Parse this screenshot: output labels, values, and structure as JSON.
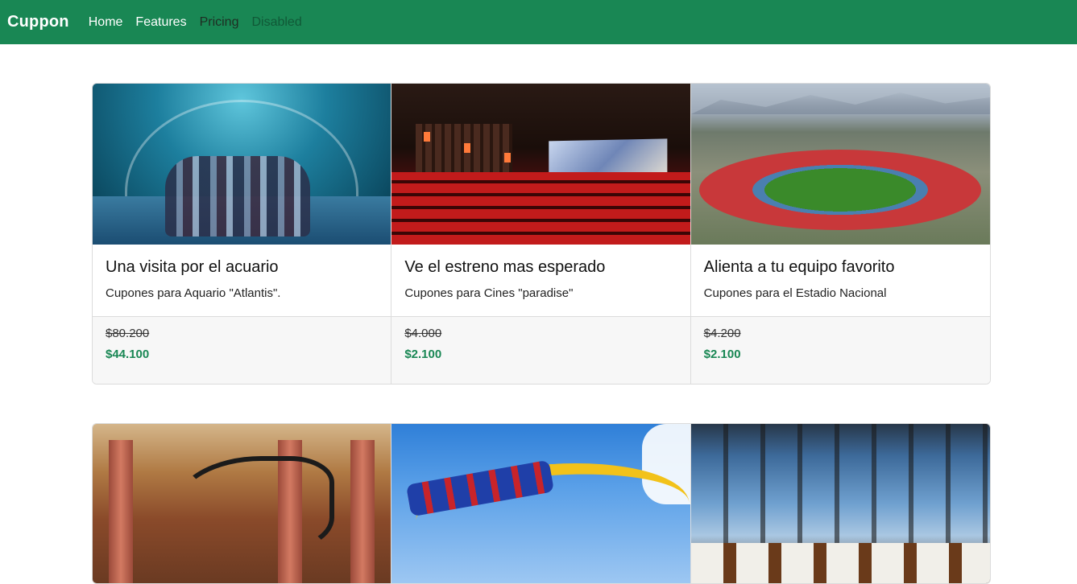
{
  "navbar": {
    "brand": "Cuppon",
    "links": [
      {
        "label": "Home"
      },
      {
        "label": "Features"
      },
      {
        "label": "Pricing"
      },
      {
        "label": "Disabled"
      }
    ]
  },
  "cards_row1": [
    {
      "title": "Una visita por el acuario",
      "text": "Cupones para Aquario \"Atlantis\".",
      "old_price": "$80.200",
      "new_price": "$44.100",
      "image": "aquarium-tunnel-photo"
    },
    {
      "title": "Ve el estreno mas esperado",
      "text": "Cupones para Cines \"paradise\"",
      "old_price": "$4.000",
      "new_price": "$2.100",
      "image": "cinema-theater-photo"
    },
    {
      "title": "Alienta a tu equipo favorito",
      "text": "Cupones para el Estadio Nacional",
      "old_price": "$4.200",
      "new_price": "$2.100",
      "image": "stadium-aerial-photo"
    }
  ],
  "cards_row2": [
    {
      "image": "museum-dinosaur-photo"
    },
    {
      "image": "roller-coaster-photo"
    },
    {
      "image": "restaurant-view-photo"
    }
  ],
  "colors": {
    "navbar_bg": "#198754",
    "price_green": "#198754"
  }
}
